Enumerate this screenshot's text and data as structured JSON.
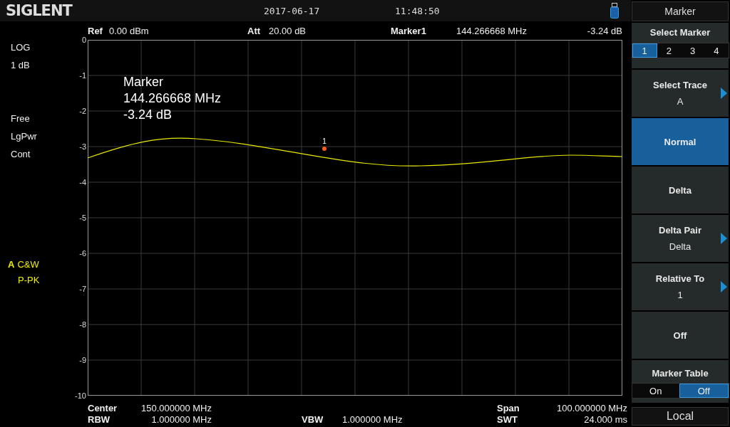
{
  "header": {
    "logo": "SIGLENT",
    "date": "2017-06-17",
    "time": "11:48:50"
  },
  "settings": {
    "ref_label": "Ref",
    "ref_value": "0.00 dBm",
    "att_label": "Att",
    "att_value": "20.00 dB",
    "marker_label": "Marker1",
    "marker_freq": "144.266668 MHz",
    "marker_level": "-3.24 dB"
  },
  "left_panel": {
    "scale_type": "LOG",
    "scale_div": "1 dB",
    "trigger": "Free",
    "detector": "LgPwr",
    "sweep": "Cont",
    "trace_name": "A",
    "trace_mode": "C&W",
    "trace_detector": "P-PK"
  },
  "graticule": {
    "yticks": [
      "0",
      "-1",
      "-2",
      "-3",
      "-4",
      "-5",
      "-6",
      "-7",
      "-8",
      "-9",
      "-10"
    ]
  },
  "marker_readout": {
    "title": "Marker",
    "frequency": "144.266668 MHz",
    "level": "-3.24 dB",
    "marker_number": "1"
  },
  "footer": {
    "center": {
      "label": "Center",
      "value": "150.000000 MHz"
    },
    "span": {
      "label": "Span",
      "value": "100.000000 MHz"
    },
    "rbw": {
      "label": "RBW",
      "value": "1.000000 MHz"
    },
    "vbw": {
      "label": "VBW",
      "value": "1.000000 MHz"
    },
    "swt": {
      "label": "SWT",
      "value": "24.000 ms"
    }
  },
  "softkeys": {
    "title": "Marker",
    "items": [
      {
        "kind": "selector",
        "label": "Select Marker",
        "options": [
          {
            "label": "1",
            "selected": true
          },
          {
            "label": "2",
            "selected": false
          },
          {
            "label": "3",
            "selected": false
          },
          {
            "label": "4",
            "selected": false
          }
        ]
      },
      {
        "kind": "submenu",
        "label": "Select Trace",
        "value": "A"
      },
      {
        "kind": "action",
        "label": "Normal",
        "selected": true
      },
      {
        "kind": "action",
        "label": "Delta",
        "selected": false
      },
      {
        "kind": "submenu",
        "label": "Delta Pair",
        "value": "Delta"
      },
      {
        "kind": "submenu",
        "label": "Relative To",
        "value": "1"
      },
      {
        "kind": "action",
        "label": "Off",
        "selected": false
      },
      {
        "kind": "toggle",
        "label": "Marker Table",
        "options": [
          {
            "label": "On",
            "selected": false
          },
          {
            "label": "Off",
            "selected": true
          }
        ]
      }
    ],
    "local_button": "Local"
  }
}
